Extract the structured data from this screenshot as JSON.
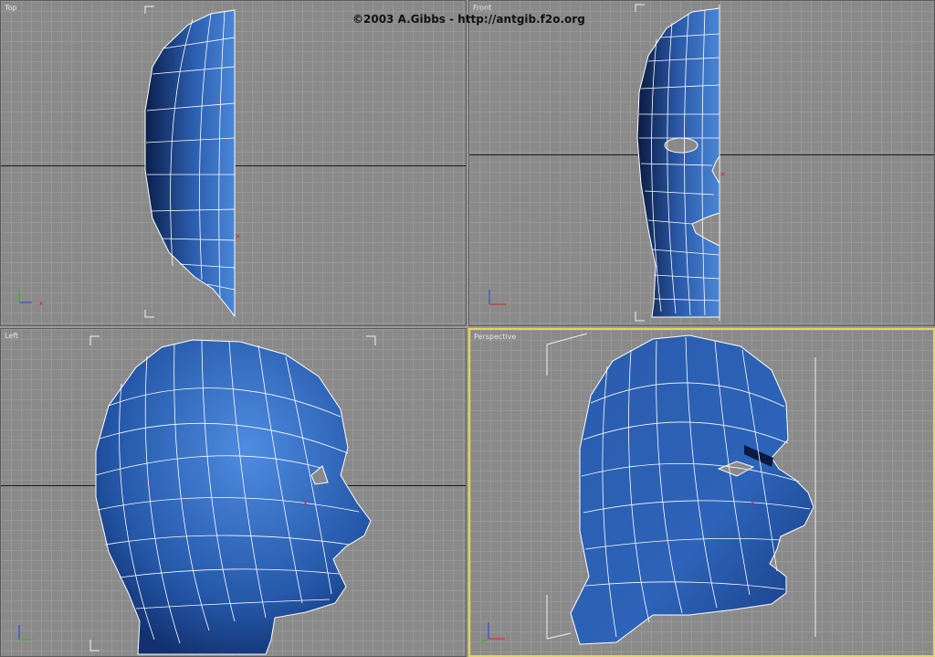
{
  "credit": "©2003 A.Gibbs - http://antgib.f2o.org",
  "viewports": {
    "top": {
      "label": "Top"
    },
    "front": {
      "label": "Front"
    },
    "left": {
      "label": "Left"
    },
    "perspective": {
      "label": "Perspective",
      "active": true
    }
  },
  "colors": {
    "viewport_bg": "#8a8a8a",
    "grid": "#a0a0a0",
    "mesh_fill": "#2e62b4",
    "mesh_edges": "#ffffff",
    "selection": "#f2f2f2",
    "active_border": "#e4d84a",
    "pivot": "#e02020"
  }
}
